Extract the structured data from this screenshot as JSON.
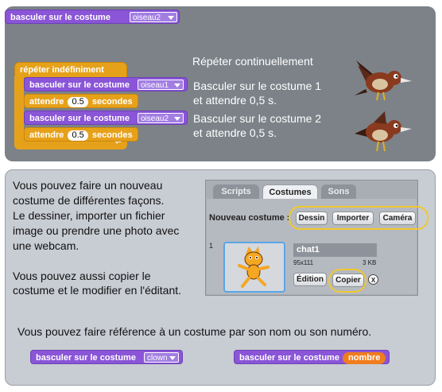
{
  "top_block": {
    "label": "basculer sur le costume",
    "value": "oiseau2"
  },
  "script": {
    "forever_label": "répéter indéfiniment",
    "switch_label": "basculer sur le costume",
    "costume_a": "oiseau1",
    "costume_b": "oiseau2",
    "wait_label": "attendre",
    "wait_value": "0.5",
    "wait_unit": "secondes"
  },
  "explain": {
    "line1": "Répéter continuellement",
    "line2a": "Basculer sur le costume 1",
    "line2b": "et attendre 0,5 s.",
    "line3a": "Basculer sur le costume 2",
    "line3b": "et attendre 0,5 s."
  },
  "bottom": {
    "para1": [
      "Vous pouvez faire un nouveau",
      "costume de différentes façons.",
      "Le dessiner, importer un fichier",
      "image ou prendre une photo avec",
      "une webcam."
    ],
    "para2": [
      "Vous pouvez aussi copier le",
      "costume et le modifier en l'éditant."
    ],
    "para3": "Vous pouvez faire référence à un costume par son nom ou son numéro."
  },
  "editor": {
    "tabs": [
      "Scripts",
      "Costumes",
      "Sons"
    ],
    "new_costume_label": "Nouveau costume :",
    "buttons": [
      "Dessin",
      "Importer",
      "Caméra"
    ],
    "costume_index": "1",
    "costume_name": "chat1",
    "costume_dims": "95x111",
    "costume_size": "3 KB",
    "edit_label": "Édition",
    "copy_label": "Copier",
    "delete_label": "X"
  },
  "examples": {
    "block1": {
      "label": "basculer sur le costume",
      "value": "clown"
    },
    "block2": {
      "label": "basculer sur le costume",
      "value": "nombre"
    }
  },
  "colors": {
    "motion_purple": "#8a55d7",
    "control_orange": "#e6a11a",
    "highlight_yellow": "#f2c82d"
  },
  "icons": [
    "bird-icon",
    "cat-sprite-icon"
  ]
}
